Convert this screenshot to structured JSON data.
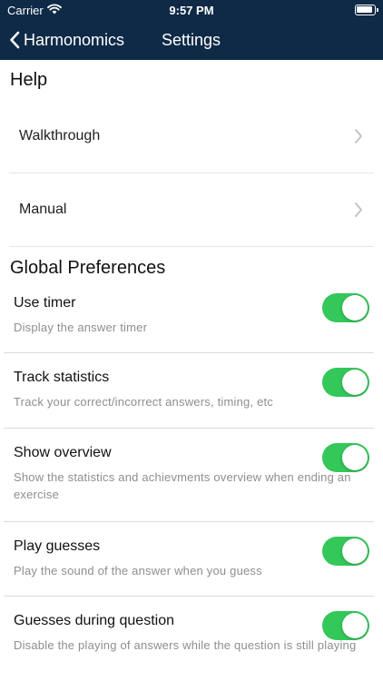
{
  "status_bar": {
    "carrier": "Carrier",
    "time": "9:57 PM"
  },
  "nav": {
    "back_label": "Harmonomics",
    "title": "Settings"
  },
  "help": {
    "heading": "Help",
    "items": [
      {
        "label": "Walkthrough",
        "icon": "chevron-right-icon"
      },
      {
        "label": "Manual",
        "icon": "chevron-right-icon"
      }
    ]
  },
  "global": {
    "heading": "Global Preferences",
    "items": [
      {
        "title": "Use timer",
        "description": "Display the answer timer",
        "enabled": true
      },
      {
        "title": "Track statistics",
        "description": "Track your correct/incorrect answers, timing, etc",
        "enabled": true
      },
      {
        "title": "Show overview",
        "description": "Show the statistics and achievments overview when ending an exercise",
        "enabled": true
      },
      {
        "title": "Play guesses",
        "description": "Play the sound of the answer when you guess",
        "enabled": true
      },
      {
        "title": "Guesses during question",
        "description": "Disable the playing of answers while the question is still playing",
        "enabled": true
      }
    ]
  },
  "colors": {
    "nav_background": "#0f2a47",
    "toggle_on": "#34c759"
  }
}
